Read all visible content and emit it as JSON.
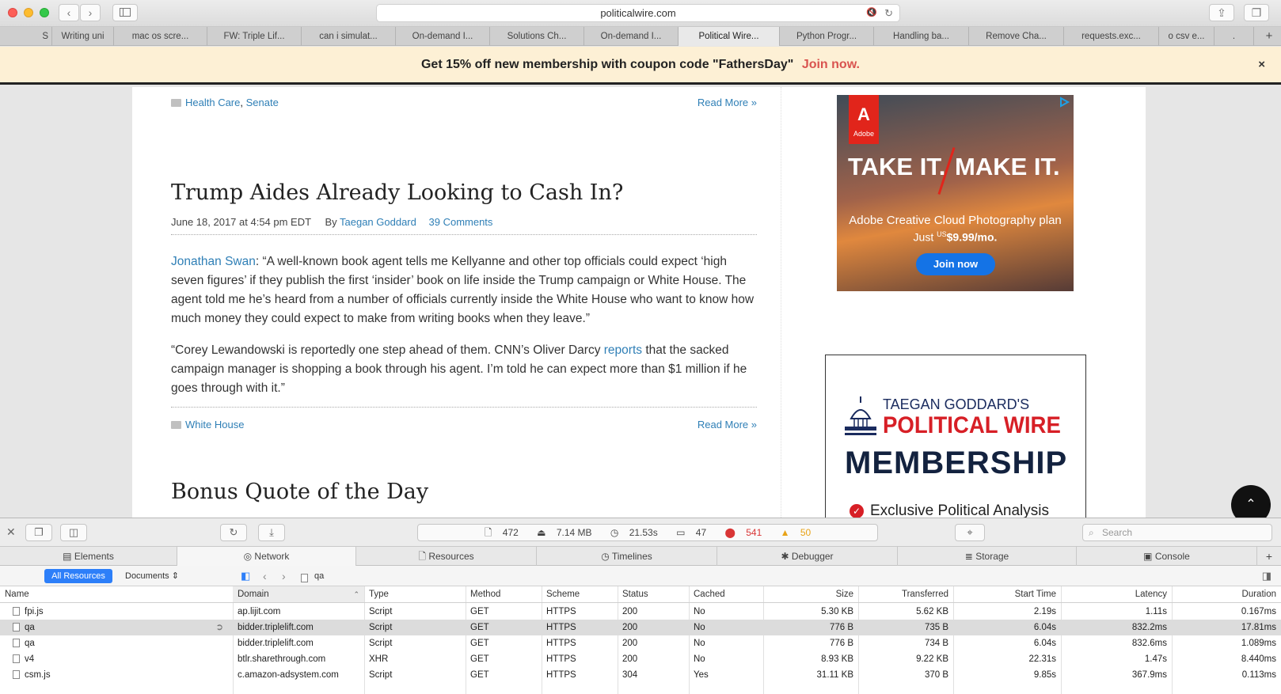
{
  "browser": {
    "url": "politicalwire.com",
    "tabs": [
      {
        "label": "S"
      },
      {
        "label": "Writing uni"
      },
      {
        "label": "mac os scre..."
      },
      {
        "label": "FW: Triple Lif..."
      },
      {
        "label": "can i simulat..."
      },
      {
        "label": "On-demand I..."
      },
      {
        "label": "Solutions Ch..."
      },
      {
        "label": "On-demand I..."
      },
      {
        "label": "Political Wire..."
      },
      {
        "label": "Python Progr..."
      },
      {
        "label": "Handling ba..."
      },
      {
        "label": "Remove Cha..."
      },
      {
        "label": "requests.exc..."
      },
      {
        "label": "o csv e..."
      },
      {
        "label": "."
      }
    ],
    "new_tab_label": "+"
  },
  "promo": {
    "text": "Get 15% off new membership with coupon code \"FathersDay\"",
    "link": "Join now.",
    "close": "×"
  },
  "article_prev": {
    "categories": [
      "Health Care",
      "Senate"
    ],
    "read_more": "Read More »"
  },
  "article": {
    "title": "Trump Aides Already Looking to Cash In?",
    "date": "June 18, 2017 at 4:54 pm EDT",
    "by_label": "By",
    "author": "Taegan Goddard",
    "comments": "39 Comments",
    "p1_link": "Jonathan Swan",
    "p1_text": ": “A well-known book agent tells me Kellyanne and other top officials could expect ‘high seven figures’ if they publish the first ‘insider’ book on life inside the Trump campaign or White House. The agent told me he’s heard from a number of officials currently inside the White House who want to know how much money they could expect to make from writing books when they leave.”",
    "p2_before": "“Corey Lewandowski is reportedly one step ahead of them. CNN’s Oliver Darcy ",
    "p2_link": "reports",
    "p2_after": " that the sacked campaign manager is shopping a book through his agent. I’m told he can expect more than $1 million if he goes through with it.”",
    "category": "White House",
    "read_more": "Read More »"
  },
  "next_article": {
    "title": "Bonus Quote of the Day"
  },
  "ad_adobe": {
    "brand": "Adobe",
    "headline_left": "TAKE IT.",
    "headline_right": "MAKE IT.",
    "line1": "Adobe Creative Cloud Photography plan",
    "line2_prefix": "Just ",
    "line2_currency": "US",
    "line2_price": "$9.99/mo.",
    "cta": "Join now"
  },
  "ad_membership": {
    "kicker": "TAEGAN GODDARD'S",
    "brand": "POLITICAL WIRE",
    "headline": "MEMBERSHIP",
    "bullet": "Exclusive Political Analysis"
  },
  "scroll_top_icon": "⌃",
  "devtools": {
    "stats": {
      "resources": "472",
      "size": "7.14 MB",
      "time": "21.53s",
      "logs": "47",
      "errors": "541",
      "warnings": "50"
    },
    "search_placeholder": "Search",
    "tabs": [
      {
        "label": "Elements"
      },
      {
        "label": "Network"
      },
      {
        "label": "Resources"
      },
      {
        "label": "Timelines"
      },
      {
        "label": "Debugger"
      },
      {
        "label": "Storage"
      },
      {
        "label": "Console"
      }
    ],
    "filter": {
      "all_resources": "All Resources",
      "documents": "Documents",
      "query": "qa"
    },
    "columns": [
      "Name",
      "Domain",
      "Type",
      "Method",
      "Scheme",
      "Status",
      "Cached",
      "Size",
      "Transferred",
      "Start Time",
      "Latency",
      "Duration"
    ],
    "rows": [
      {
        "name": "fpi.js",
        "domain": "ap.lijit.com",
        "type": "Script",
        "method": "GET",
        "scheme": "HTTPS",
        "status": "200",
        "cached": "No",
        "size": "5.30 KB",
        "transferred": "5.62 KB",
        "start": "2.19s",
        "latency": "1.11s",
        "duration": "0.167ms"
      },
      {
        "name": "qa",
        "domain": "bidder.triplelift.com",
        "type": "Script",
        "method": "GET",
        "scheme": "HTTPS",
        "status": "200",
        "cached": "No",
        "size": "776 B",
        "transferred": "735 B",
        "start": "6.04s",
        "latency": "832.2ms",
        "duration": "17.81ms"
      },
      {
        "name": "qa",
        "domain": "bidder.triplelift.com",
        "type": "Script",
        "method": "GET",
        "scheme": "HTTPS",
        "status": "200",
        "cached": "No",
        "size": "776 B",
        "transferred": "734 B",
        "start": "6.04s",
        "latency": "832.6ms",
        "duration": "1.089ms"
      },
      {
        "name": "v4",
        "domain": "btlr.sharethrough.com",
        "type": "XHR",
        "method": "GET",
        "scheme": "HTTPS",
        "status": "200",
        "cached": "No",
        "size": "8.93 KB",
        "transferred": "9.22 KB",
        "start": "22.31s",
        "latency": "1.47s",
        "duration": "8.440ms"
      },
      {
        "name": "csm.js",
        "domain": "c.amazon-adsystem.com",
        "type": "Script",
        "method": "GET",
        "scheme": "HTTPS",
        "status": "304",
        "cached": "Yes",
        "size": "31.11 KB",
        "transferred": "370 B",
        "start": "9.85s",
        "latency": "367.9ms",
        "duration": "0.113ms"
      }
    ]
  },
  "colors": {
    "link": "#2f7fb6",
    "promo_bg": "#fdf0d5",
    "promo_link": "#d9534f",
    "devtools_accent": "#2d7ff9",
    "error": "#d93636",
    "warning": "#e8a317"
  }
}
